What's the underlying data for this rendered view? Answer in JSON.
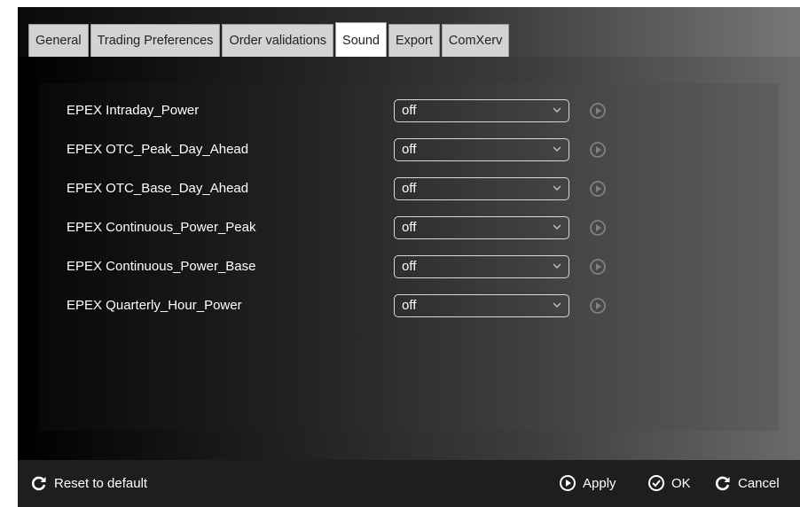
{
  "tabs": [
    {
      "label": "General"
    },
    {
      "label": "Trading Preferences"
    },
    {
      "label": "Order validations"
    },
    {
      "label": "Sound",
      "active": true
    },
    {
      "label": "Export"
    },
    {
      "label": "ComXerv"
    }
  ],
  "sound_rows": [
    {
      "label": "EPEX Intraday_Power",
      "value": "off"
    },
    {
      "label": "EPEX OTC_Peak_Day_Ahead",
      "value": "off"
    },
    {
      "label": "EPEX OTC_Base_Day_Ahead",
      "value": "off"
    },
    {
      "label": "EPEX Continuous_Power_Peak",
      "value": "off"
    },
    {
      "label": "EPEX Continuous_Power_Base",
      "value": "off"
    },
    {
      "label": "EPEX Quarterly_Hour_Power",
      "value": "off"
    }
  ],
  "footer": {
    "reset_label": "Reset to default",
    "apply_label": "Apply",
    "ok_label": "OK",
    "cancel_label": "Cancel"
  },
  "icons": {
    "reset": "refresh-icon",
    "apply": "play-circle-icon",
    "ok": "check-circle-icon",
    "cancel": "refresh-icon",
    "dropdown": "chevron-down-icon",
    "row_play": "play-circle-icon"
  },
  "colors": {
    "active_tab": "#ffffff",
    "inactive_tab": "#d3d3d3",
    "footer_bg": "#1e1e1e",
    "text": "#ffffff",
    "play_icon": "#808080"
  }
}
